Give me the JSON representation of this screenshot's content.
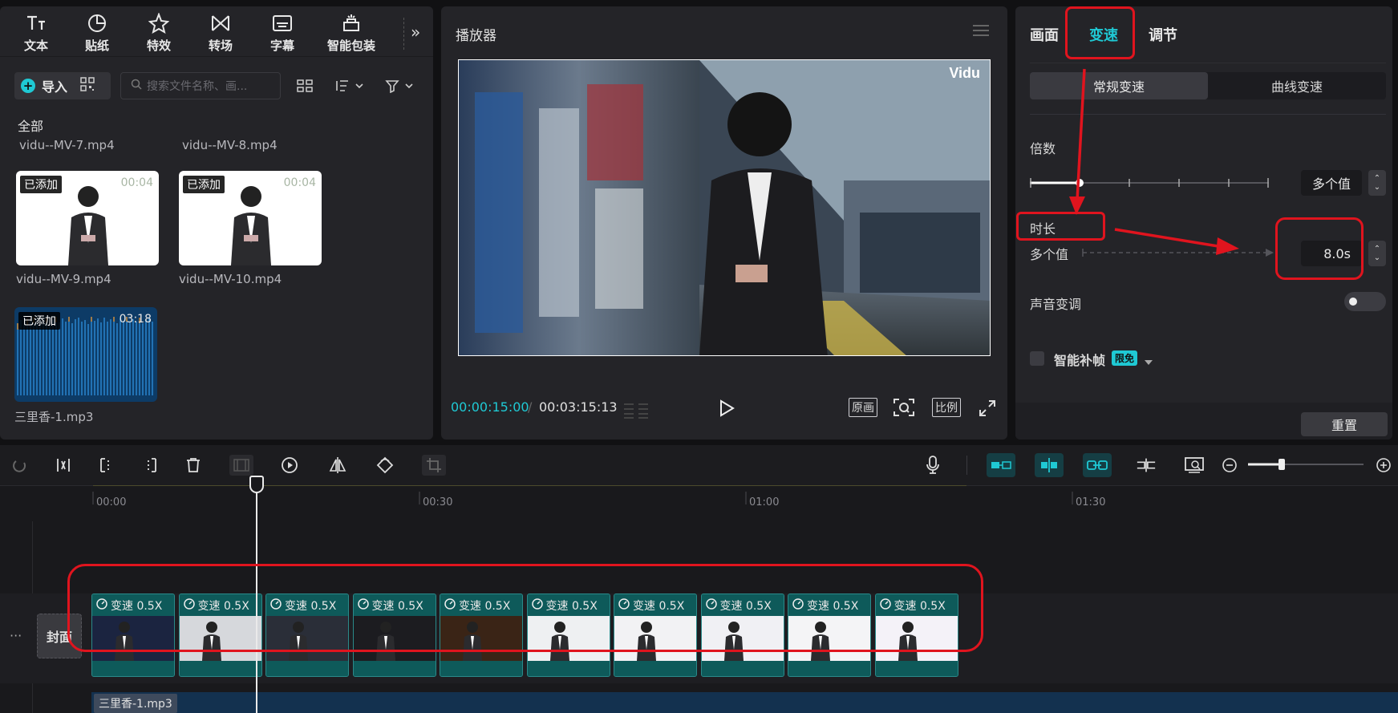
{
  "toolbar": {
    "tools": [
      {
        "label": "文本",
        "icon": "text-icon"
      },
      {
        "label": "贴纸",
        "icon": "sticker-icon"
      },
      {
        "label": "特效",
        "icon": "effects-icon"
      },
      {
        "label": "转场",
        "icon": "transition-icon"
      },
      {
        "label": "字幕",
        "icon": "subtitle-icon"
      },
      {
        "label": "智能包装",
        "icon": "smart-pack-icon"
      }
    ]
  },
  "media": {
    "import_label": "导入",
    "search_placeholder": "搜索文件名称、画...",
    "filter_all": "全部",
    "top_names": [
      "vidu--MV-7.mp4",
      "vidu--MV-8.mp4"
    ],
    "items": [
      {
        "name": "vidu--MV-9.mp4",
        "badge": "已添加",
        "duration": "00:04"
      },
      {
        "name": "vidu--MV-10.mp4",
        "badge": "已添加",
        "duration": "00:04"
      },
      {
        "name": "三里香-1.mp3",
        "badge": "已添加",
        "duration": "03:18"
      }
    ]
  },
  "player": {
    "title": "播放器",
    "watermark": "Vidu",
    "current_time": "00:00:15:00",
    "separator": "/",
    "total_time": "00:03:15:13",
    "btn_original": "原画",
    "btn_ratio": "比例"
  },
  "inspector": {
    "tabs": [
      "画面",
      "变速",
      "调节"
    ],
    "active_tab": "变速",
    "accent": "#1fc9d4",
    "segment": [
      "常规变速",
      "曲线变速"
    ],
    "multiplier_label": "倍数",
    "multiplier_value": "多个值",
    "duration_label": "时长",
    "duration_from": "多个值",
    "duration_value": "8.0s",
    "pitch_label": "声音变调",
    "smart_frame_label": "智能补帧",
    "free_badge": "限免",
    "reset_label": "重置"
  },
  "timeline": {
    "ruler": [
      "00:00",
      "00:30",
      "01:00",
      "01:30"
    ],
    "cover_label": "封面",
    "clip_speed_label": "变速 0.5X",
    "clip_count": 10,
    "audio_name": "三里香-1.mp3"
  },
  "annotation_color": "#e0141e"
}
